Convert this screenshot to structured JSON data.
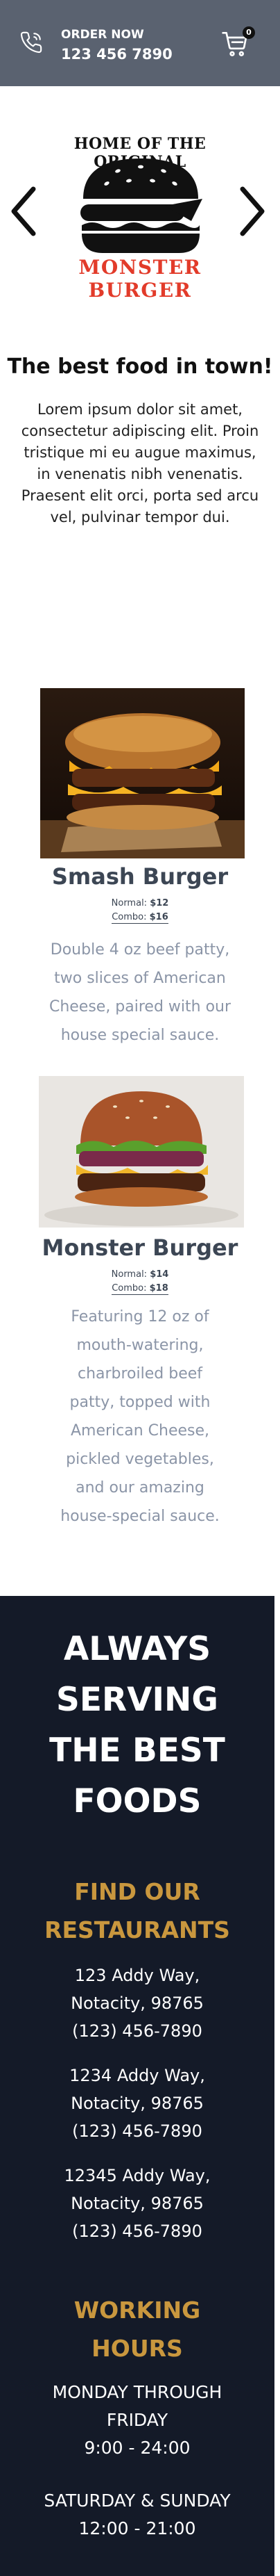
{
  "header": {
    "order_label": "ORDER NOW",
    "order_number": "123 456 7890",
    "cart_count": "0"
  },
  "logo": {
    "top_text": "HOME OF THE ORIGINAL",
    "bottom_text": "MONSTER BURGER"
  },
  "intro": {
    "title": "The best food in town!",
    "text": "Lorem ipsum dolor sit amet, consectetur adipiscing elit. Proin tristique mi eu augue maximus, in venenatis nibh venenatis. Praesent elit orci, porta sed arcu vel, pulvinar tempor dui."
  },
  "menu": [
    {
      "name": "Smash Burger",
      "normal_label": "Normal:",
      "normal_price": "$12",
      "combo_label": "Combo:",
      "combo_price": "$16",
      "description": "Double 4 oz beef patty, two slices of American Cheese, paired with our house special sauce."
    },
    {
      "name": "Monster Burger",
      "normal_label": "Normal:",
      "normal_price": "$14",
      "combo_label": "Combo:",
      "combo_price": "$18",
      "description": "Featuring 12 oz of mouth-watering, charbroiled beef patty, topped with American Cheese, pickled vegetables, and our amazing house-special sauce."
    }
  ],
  "footer": {
    "slogan": "ALWAYS SERVING THE BEST FOODS",
    "find_heading": "FIND OUR RESTAURANTS",
    "addresses": [
      {
        "street": "123 Addy Way,",
        "city": "Notacity, 98765",
        "phone": "(123) 456-7890"
      },
      {
        "street": "1234 Addy Way,",
        "city": "Notacity, 98765",
        "phone": "(123) 456-7890"
      },
      {
        "street": "12345 Addy Way,",
        "city": "Notacity, 98765",
        "phone": "(123) 456-7890"
      }
    ],
    "hours_heading": "WORKING HOURS",
    "hours": [
      {
        "days": "MONDAY THROUGH FRIDAY",
        "time": "9:00 - 24:00"
      },
      {
        "days": "SATURDAY & SUNDAY",
        "time": "12:00 - 21:00"
      }
    ]
  },
  "colors": {
    "topbar": "#5a6270",
    "footer_bg": "#141a28",
    "gold": "#c9973e",
    "logo_red": "#e23b2a",
    "item_name": "#3c4654",
    "item_desc": "#8b95a7"
  },
  "icons": {
    "phone": "phone-icon",
    "cart": "shopping-cart-icon",
    "prev": "chevron-left-icon",
    "next": "chevron-right-icon"
  }
}
